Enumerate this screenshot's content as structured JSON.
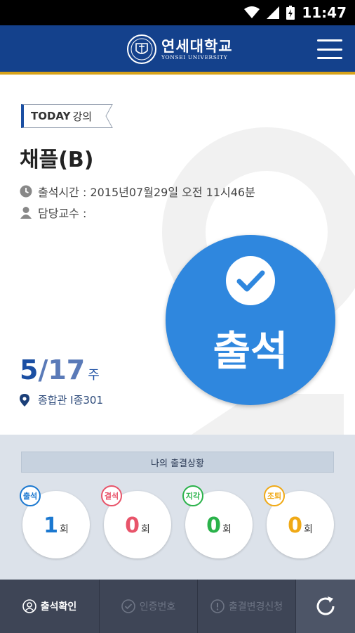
{
  "status_bar": {
    "time": "11:47"
  },
  "header": {
    "logo_korean": "연세대학교",
    "logo_english": "YONSEI UNIVERSITY"
  },
  "today": {
    "badge_main": "TODAY",
    "badge_sub": "강의",
    "course_title": "채플(B)",
    "attendance_time": "출석시간 : 2015년07월29일 오전 11시46분",
    "professor": "담당교수 :",
    "week_current": "5",
    "week_total": "/17",
    "week_unit": "주",
    "location": "종합관 I종301",
    "attend_button": "출석"
  },
  "status": {
    "title": "나의 출결상황",
    "items": [
      {
        "tag": "출석",
        "count": "1",
        "unit": "회",
        "color": "#1b78d0"
      },
      {
        "tag": "결석",
        "count": "0",
        "unit": "회",
        "color": "#e8546a"
      },
      {
        "tag": "지각",
        "count": "0",
        "unit": "회",
        "color": "#2ab24a"
      },
      {
        "tag": "조퇴",
        "count": "0",
        "unit": "회",
        "color": "#f0a915"
      }
    ]
  },
  "bottom_nav": {
    "items": [
      {
        "label": "출석확인",
        "icon": "person-icon"
      },
      {
        "label": "인증번호",
        "icon": "check-circle-icon"
      },
      {
        "label": "출결변경신청",
        "icon": "alert-icon"
      }
    ],
    "refresh_icon": "refresh-icon"
  }
}
